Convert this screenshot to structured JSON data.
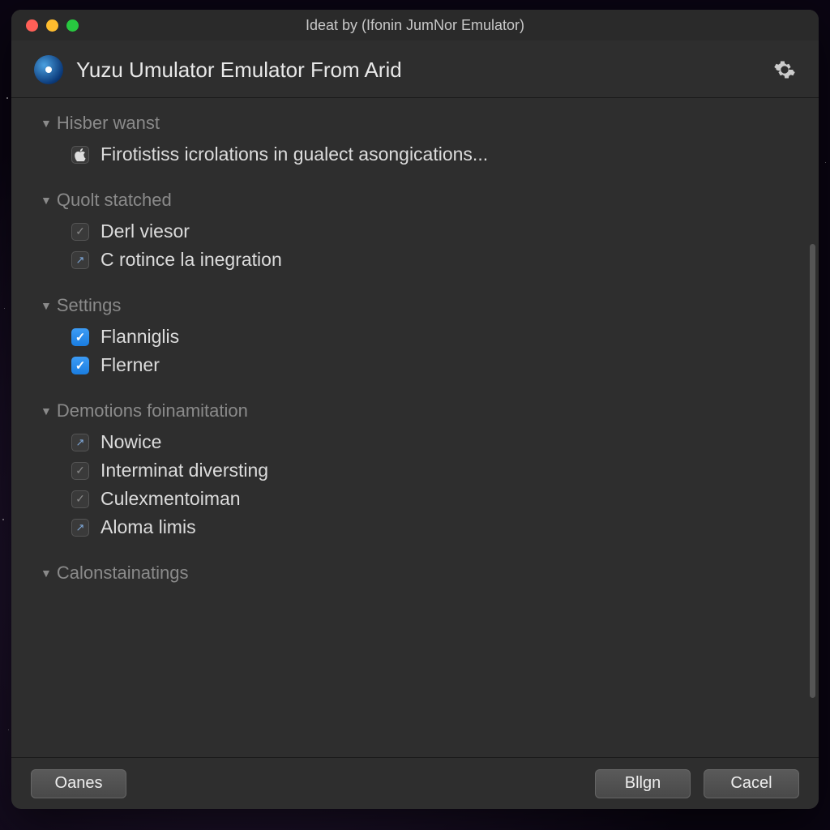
{
  "window_title": "Ideat by (Ifonin JumNor Emulator)",
  "header_title": "Yuzu Umulator Emulator From Arid",
  "sections": [
    {
      "title": "Hisber wanst",
      "items": [
        {
          "label": "Firotistiss icrolations in gualect asongications...",
          "icon": "apple",
          "interactable": true
        }
      ]
    },
    {
      "title": "Quolt statched",
      "items": [
        {
          "label": "Derl viesor",
          "icon": "dark-check",
          "interactable": true
        },
        {
          "label": "C rotince la inegration",
          "icon": "slash",
          "interactable": true
        }
      ]
    },
    {
      "title": "Settings",
      "items": [
        {
          "label": "Flanniglis",
          "icon": "blue-check",
          "interactable": true
        },
        {
          "label": "Flerner",
          "icon": "blue-check",
          "interactable": true
        }
      ]
    },
    {
      "title": "Demotions foinamitation",
      "items": [
        {
          "label": "Nowice",
          "icon": "slash",
          "interactable": true
        },
        {
          "label": "Interminat diversting",
          "icon": "dark-check",
          "interactable": true
        },
        {
          "label": "Culexmentoiman",
          "icon": "dark-check",
          "interactable": true
        },
        {
          "label": "Aloma limis",
          "icon": "slash",
          "interactable": true
        }
      ]
    },
    {
      "title": "Calonstainatings",
      "items": []
    }
  ],
  "buttons": {
    "left": "Oanes",
    "middle": "Bllgn",
    "right": "Cacel"
  }
}
